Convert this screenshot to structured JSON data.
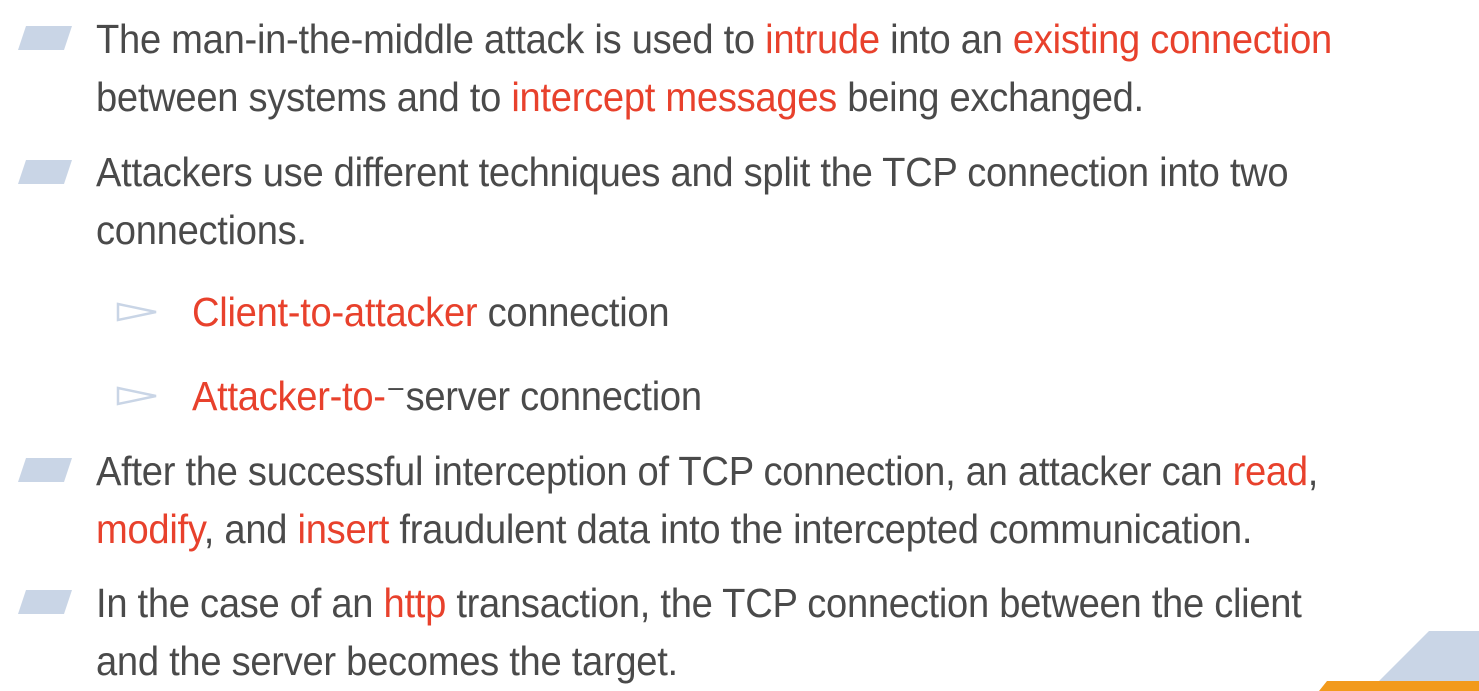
{
  "colors": {
    "text": "#4a4a4a",
    "highlight": "#e8412c",
    "bullet": "#c9d5e6",
    "corner_blue": "#c9d5e6",
    "corner_orange": "#f29a1c"
  },
  "bullets": [
    {
      "marker_icon": "parallelogram-bullet-icon",
      "line1": [
        {
          "text": "The man-in-the-middle attack is used to ",
          "hl": false
        },
        {
          "text": "intrude",
          "hl": true
        },
        {
          "text": " into an ",
          "hl": false
        },
        {
          "text": "existing connection",
          "hl": true
        }
      ],
      "line2": [
        {
          "text": "between systems and to ",
          "hl": false
        },
        {
          "text": "intercept messages",
          "hl": true
        },
        {
          "text": " being exchanged.",
          "hl": false
        }
      ]
    },
    {
      "marker_icon": "parallelogram-bullet-icon",
      "line1": [
        {
          "text": "Attackers use different techniques and split the TCP connection into two",
          "hl": false
        }
      ],
      "line2": [
        {
          "text": "connections.",
          "hl": false
        }
      ],
      "sub_items": [
        {
          "icon": "hollow-arrow-icon",
          "parts": [
            {
              "text": "Client-to-attacker",
              "hl": true
            },
            {
              "text": " connection",
              "hl": false
            }
          ]
        },
        {
          "icon": "hollow-arrow-icon",
          "parts": [
            {
              "text": "Attacker-to-",
              "hl": true
            },
            {
              "text": "⁻server connection",
              "hl": false
            }
          ]
        }
      ]
    },
    {
      "marker_icon": "parallelogram-bullet-icon",
      "line1": [
        {
          "text": "After the successful interception of TCP connection, an attacker can ",
          "hl": false
        },
        {
          "text": "read",
          "hl": true
        },
        {
          "text": ",",
          "hl": false
        }
      ],
      "line2": [
        {
          "text": "modify",
          "hl": true
        },
        {
          "text": ", and ",
          "hl": false
        },
        {
          "text": "insert",
          "hl": true
        },
        {
          "text": " fraudulent data into the intercepted communication.",
          "hl": false
        }
      ]
    },
    {
      "marker_icon": "parallelogram-bullet-icon",
      "line1": [
        {
          "text": "In the case of an ",
          "hl": false
        },
        {
          "text": "http",
          "hl": true
        },
        {
          "text": " transaction, the TCP connection between the client",
          "hl": false
        }
      ],
      "line2": [
        {
          "text": "and the server becomes the target.",
          "hl": false
        }
      ]
    }
  ]
}
